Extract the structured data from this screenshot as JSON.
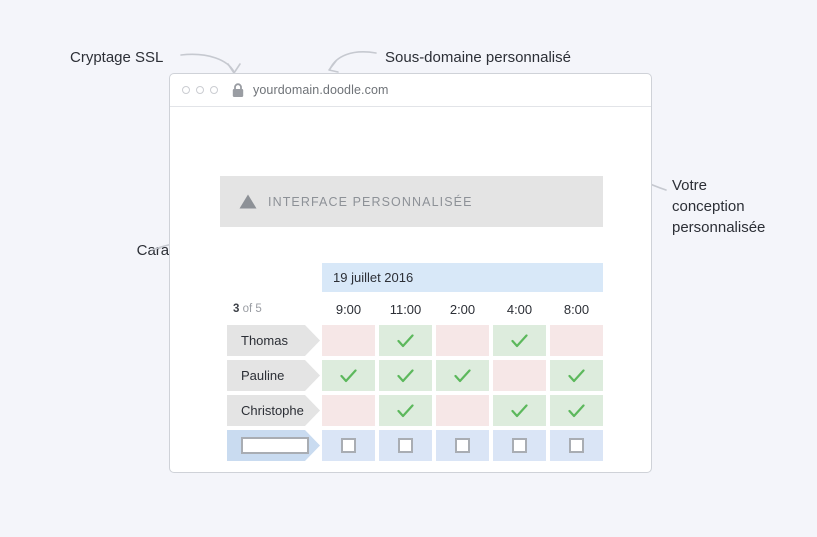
{
  "background_color": "#f4f5fa",
  "annotations": [
    {
      "id": "ssl",
      "text": "Cryptage SSL"
    },
    {
      "id": "subdomain",
      "text": "Sous-domaine personnalisé"
    },
    {
      "id": "design",
      "text": "Votre\nconception\npersonnalisée"
    },
    {
      "id": "features",
      "text": "Caractéristiques\nd'efficacité"
    }
  ],
  "browser": {
    "window_dots": 3,
    "lock_icon": "lock-icon",
    "url": "yourdomain.doodle.com"
  },
  "banner": {
    "logo_icon": "triangle-logo-icon",
    "label": "INTERFACE PERSONNALISÉE",
    "background": "#e4e4e4",
    "text_color": "#8d9197"
  },
  "poll": {
    "date_label": "19 juillet 2016",
    "date_bar_color": "#d8e8f8",
    "participant_count_bold": "3",
    "participant_count_rest": " of 5",
    "times": [
      "9:00",
      "11:00",
      "2:00",
      "4:00",
      "8:00"
    ],
    "colors": {
      "yes": "#ddecdd",
      "no": "#f6e7e7",
      "vote": "#dae5f6",
      "check": "#5cb85c",
      "pennant": "#e4e4e4",
      "pennant_voter": "#c9dbf0"
    },
    "rows": [
      {
        "name": "Thomas",
        "answers": [
          "no",
          "yes",
          "no",
          "yes",
          "no"
        ]
      },
      {
        "name": "Pauline",
        "answers": [
          "yes",
          "yes",
          "yes",
          "no",
          "yes"
        ]
      },
      {
        "name": "Christophe",
        "answers": [
          "no",
          "yes",
          "no",
          "yes",
          "yes"
        ]
      }
    ],
    "vote_row": {
      "name_placeholder": "",
      "checkboxes": [
        "unchecked",
        "unchecked",
        "unchecked",
        "unchecked",
        "unchecked"
      ]
    }
  }
}
